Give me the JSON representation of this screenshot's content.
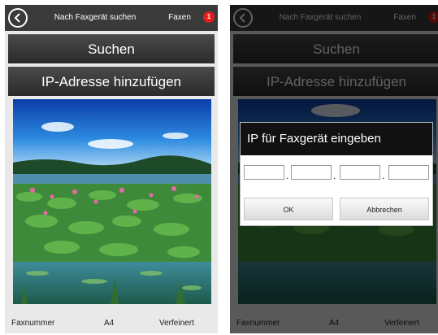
{
  "topbar": {
    "title": "Nach Faxgerät suchen",
    "fax_tab": "Faxen",
    "badge_count": "1"
  },
  "buttons": {
    "search": "Suchen",
    "add_ip": "IP-Adresse hinzufügen"
  },
  "bottom": {
    "fax_number": "Faxnummer",
    "paper": "A4",
    "quality": "Verfeinert"
  },
  "dialog": {
    "title": "IP für Faxgerät eingeben",
    "fields": [
      "",
      "",
      "",
      ""
    ],
    "separator": ".",
    "ok": "OK",
    "cancel": "Abbrechen"
  },
  "icons": {
    "back": "back-arrow-circle-icon"
  },
  "colors": {
    "bar": "#3a3a3a",
    "badge": "#e11d1d",
    "dialog_title_bg": "#111111"
  }
}
